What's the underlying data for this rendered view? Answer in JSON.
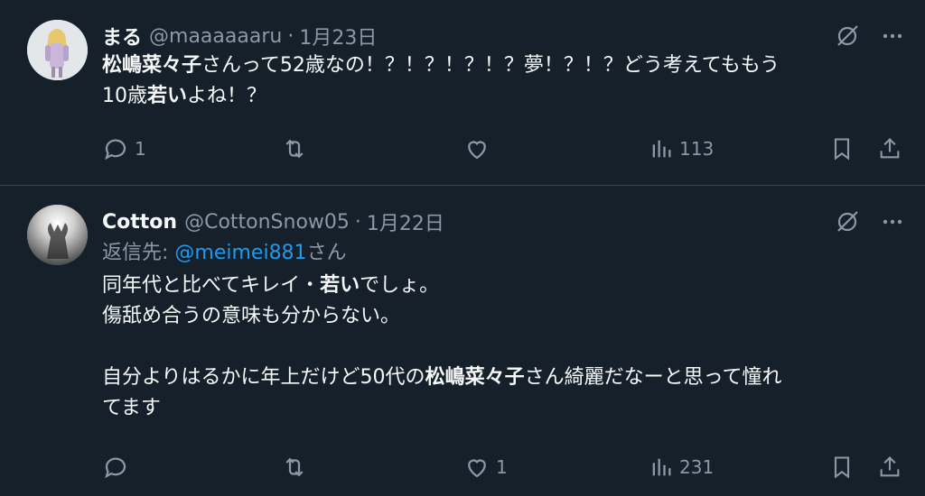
{
  "tweets": [
    {
      "name": "まる",
      "handle": "@maaaaaaru",
      "sep": "·",
      "date": "1月23日",
      "text_lines": [
        [
          {
            "t": "松嶋菜々子",
            "b": true
          },
          {
            "t": "さんって52歳なの！？！？！？！？夢！？！？どう考えてももう",
            "b": false
          }
        ],
        [
          {
            "t": "10歳",
            "b": false
          },
          {
            "t": "若い",
            "b": true
          },
          {
            "t": "よね！？",
            "b": false
          }
        ]
      ],
      "reply_count": "1",
      "retweet_count": "",
      "like_count": "",
      "view_count": "113"
    },
    {
      "name": "Cotton",
      "handle": "@CottonSnow05",
      "sep": "·",
      "date": "1月22日",
      "reply_prefix": "返信先: ",
      "reply_mention": "@meimei881",
      "reply_suffix": "さん",
      "text_lines": [
        [
          {
            "t": "同年代と比べてキレイ・",
            "b": false
          },
          {
            "t": "若い",
            "b": true
          },
          {
            "t": "でしょ。",
            "b": false
          }
        ],
        [
          {
            "t": "傷舐め合うの意味も分からない。",
            "b": false
          }
        ],
        [],
        [
          {
            "t": "自分よりはるかに年上だけど50代の",
            "b": false
          },
          {
            "t": "松嶋菜々子",
            "b": true
          },
          {
            "t": "さん綺麗だなーと思って憧れ",
            "b": false
          }
        ],
        [
          {
            "t": "てます",
            "b": false
          }
        ]
      ],
      "reply_count": "",
      "retweet_count": "",
      "like_count": "1",
      "view_count": "231"
    }
  ],
  "icons": {
    "grok": "grok-icon",
    "more": "more-icon",
    "reply": "reply-icon",
    "retweet": "retweet-icon",
    "like": "heart-icon",
    "views": "views-icon",
    "bookmark": "bookmark-icon",
    "share": "share-icon"
  },
  "colors": {
    "background": "#15202b",
    "text": "#f7f9f9",
    "secondary": "#8b98a5",
    "link": "#1d9bf0",
    "divider": "#38444d"
  }
}
